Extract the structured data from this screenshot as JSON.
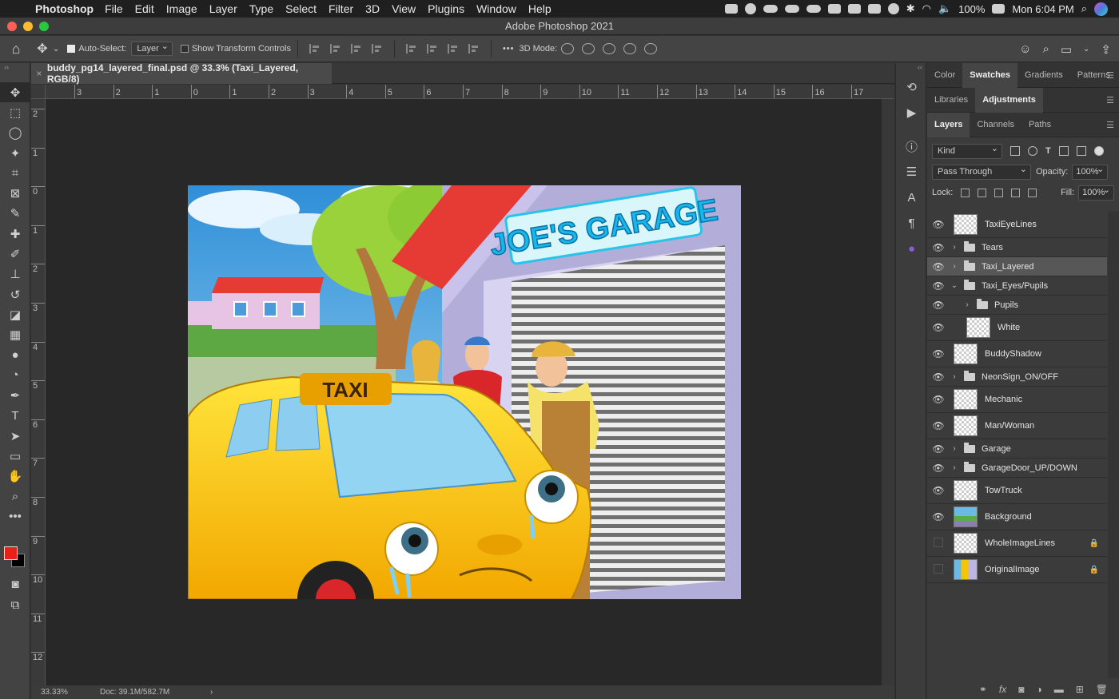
{
  "menubar": {
    "apple": "",
    "app_name": "Photoshop",
    "items": [
      "File",
      "Edit",
      "Image",
      "Layer",
      "Type",
      "Select",
      "Filter",
      "3D",
      "View",
      "Plugins",
      "Window",
      "Help"
    ],
    "battery": "100%",
    "clock": "Mon 6:04 PM"
  },
  "window": {
    "title": "Adobe Photoshop 2021"
  },
  "options": {
    "auto_select_label": "Auto-Select:",
    "auto_select_value": "Layer",
    "show_transform_label": "Show Transform Controls",
    "mode_3d_label": "3D Mode:",
    "more": "•••"
  },
  "document": {
    "tab_title": "buddy_pg14_layered_final.psd @ 33.3% (Taxi_Layered, RGB/8)",
    "close": "×"
  },
  "rulers": {
    "top": [
      "3",
      "2",
      "1",
      "0",
      "1",
      "2",
      "3",
      "4",
      "5",
      "6",
      "7",
      "8",
      "9",
      "10",
      "11",
      "12",
      "13",
      "14",
      "15",
      "16",
      "17"
    ],
    "left": [
      "2",
      "1",
      "0",
      "1",
      "2",
      "3",
      "4",
      "5",
      "6",
      "7",
      "8",
      "9",
      "10",
      "11",
      "12"
    ]
  },
  "status": {
    "zoom": "33.33%",
    "doc": "Doc: 39.1M/582.7M",
    "arrow": "›"
  },
  "artwork": {
    "sign_text": "JOE'S GARAGE",
    "taxi_text": "TAXI"
  },
  "panels": {
    "group1_tabs": [
      "Color",
      "Swatches",
      "Gradients",
      "Patterns"
    ],
    "group2_tabs": [
      "Libraries",
      "Adjustments"
    ],
    "group3_tabs": [
      "Layers",
      "Channels",
      "Paths"
    ],
    "menu": "☰",
    "kind": "Kind",
    "blend_mode": "Pass Through",
    "opacity_label": "Opacity:",
    "opacity": "100%",
    "lock_label": "Lock:",
    "fill_label": "Fill:",
    "fill": "100%"
  },
  "layers": [
    {
      "name": "TaxiEyeLines",
      "type": "layer",
      "thumb": "checker",
      "visible": true,
      "indent": 0,
      "height": 33
    },
    {
      "name": "Tears",
      "type": "group",
      "expanded": false,
      "visible": true,
      "indent": 0,
      "height": 24
    },
    {
      "name": "Taxi_Layered",
      "type": "group",
      "expanded": false,
      "visible": true,
      "indent": 0,
      "height": 24,
      "selected": true
    },
    {
      "name": "Taxi_Eyes/Pupils",
      "type": "group",
      "expanded": true,
      "visible": true,
      "indent": 0,
      "height": 24
    },
    {
      "name": "Pupils",
      "type": "group",
      "expanded": false,
      "visible": true,
      "indent": 1,
      "height": 24
    },
    {
      "name": "White",
      "type": "layer",
      "thumb": "checker",
      "visible": true,
      "indent": 1,
      "height": 33
    },
    {
      "name": "BuddyShadow",
      "type": "layer",
      "thumb": "checker",
      "visible": true,
      "indent": 0,
      "height": 33
    },
    {
      "name": "NeonSign_ON/OFF",
      "type": "group",
      "expanded": false,
      "visible": true,
      "indent": 0,
      "height": 24
    },
    {
      "name": "Mechanic",
      "type": "layer",
      "thumb": "checker",
      "visible": true,
      "indent": 0,
      "height": 33
    },
    {
      "name": "Man/Woman",
      "type": "layer",
      "thumb": "checker",
      "visible": true,
      "indent": 0,
      "height": 33
    },
    {
      "name": "Garage",
      "type": "group",
      "expanded": false,
      "visible": true,
      "indent": 0,
      "height": 24
    },
    {
      "name": "GarageDoor_UP/DOWN",
      "type": "group",
      "expanded": false,
      "visible": true,
      "indent": 0,
      "height": 24
    },
    {
      "name": "TowTruck",
      "type": "layer",
      "thumb": "checker",
      "visible": true,
      "indent": 0,
      "height": 33
    },
    {
      "name": "Background",
      "type": "layer",
      "thumb": "bgimg",
      "visible": true,
      "indent": 0,
      "height": 33
    },
    {
      "name": "WholeImageLines",
      "type": "layer",
      "thumb": "checker",
      "visible": false,
      "indent": 0,
      "height": 33,
      "locked": true
    },
    {
      "name": "OriginalImage",
      "type": "layer",
      "thumb": "origimg",
      "visible": false,
      "indent": 0,
      "height": 33,
      "locked": true
    }
  ],
  "colors": {
    "foreground": "#e8201a",
    "background": "#000000",
    "selected_layer": "#575757"
  }
}
